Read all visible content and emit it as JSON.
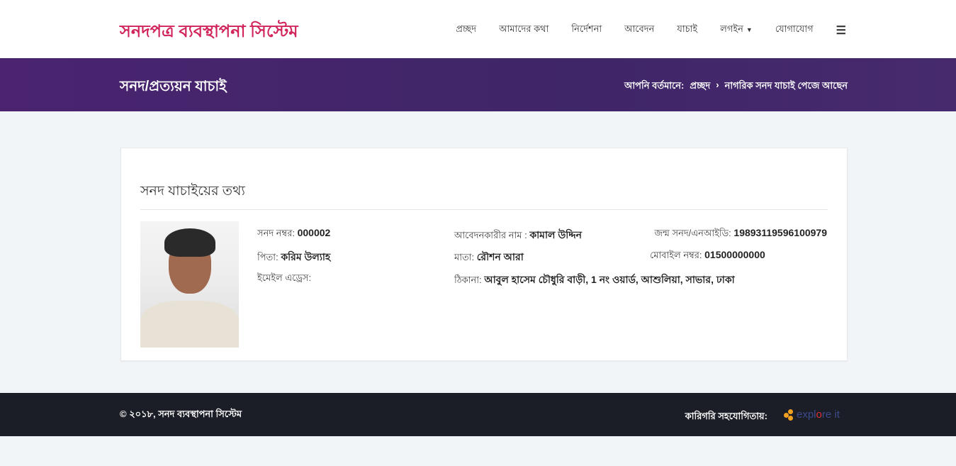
{
  "header": {
    "logo": "সনদপত্র ব্যবস্থাপনা সিস্টেম",
    "nav": [
      "প্রচ্ছদ",
      "আমাদের কথা",
      "নির্দেশনা",
      "আবেদন",
      "যাচাই",
      "লগইন",
      "যোগাযোগ"
    ]
  },
  "banner": {
    "title": "সনদ/প্রত্যয়ন যাচাই",
    "crumb_prefix": "আপনি বর্তমানে:",
    "crumb_home": "প্রচ্ছদ",
    "crumb_sep": "›",
    "crumb_current": "নাগরিক সনদ যাচাই পেজে আছেন"
  },
  "card": {
    "title": "সনদ যাচাইয়ের তথ্য",
    "fields": {
      "cert_no": {
        "label": "সনদ নম্বর:",
        "value": "000002"
      },
      "applicant": {
        "label": "আবেদনকারীর নাম :",
        "value": "কামাল উদ্দিন"
      },
      "nid": {
        "label": "জন্ম সনদ/এনআইডি:",
        "value": "19893119596100979"
      },
      "father": {
        "label": "পিতা:",
        "value": "করিম উল্যাহ"
      },
      "mother": {
        "label": "মাতা:",
        "value": "রৌশন আরা"
      },
      "mobile": {
        "label": "মোবাইল নম্বর:",
        "value": "01500000000"
      },
      "email": {
        "label": "ইমেইল এড্রেস:",
        "value": ""
      },
      "address": {
        "label": "ঠিকানা:",
        "value": "আবুল হাসেম চৌধুরি বাড়ী, 1 নং ওয়ার্ড, আশুলিয়া, সাভার, ঢাকা"
      }
    }
  },
  "footer": {
    "copyright": "© ২০১৮,  সনদ ব্যবস্থাপনা সিস্টেম",
    "credit": "কারিগরি সহযোগিতায়:",
    "brand_a": "expl",
    "brand_o": "o",
    "brand_b": "re it"
  }
}
